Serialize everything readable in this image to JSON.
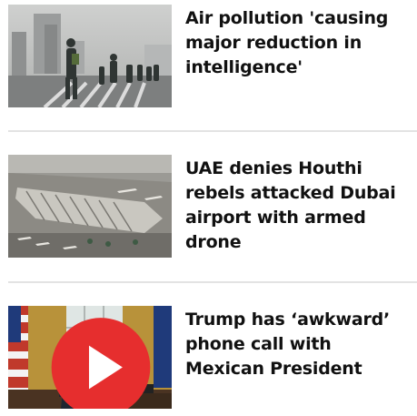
{
  "stories": [
    {
      "headline": "Air pollution 'causing major reduction in intelligence'"
    },
    {
      "headline": "UAE denies Houthi rebels attacked Dubai airport with armed drone"
    },
    {
      "headline": "Trump has ‘awkward’ phone call with Mexican President",
      "has_video": true
    }
  ],
  "icons": {
    "video_play": "play-icon"
  },
  "colors": {
    "headline_text": "#111111",
    "divider": "#e3e3e3",
    "play_badge": "#e62e2e"
  }
}
